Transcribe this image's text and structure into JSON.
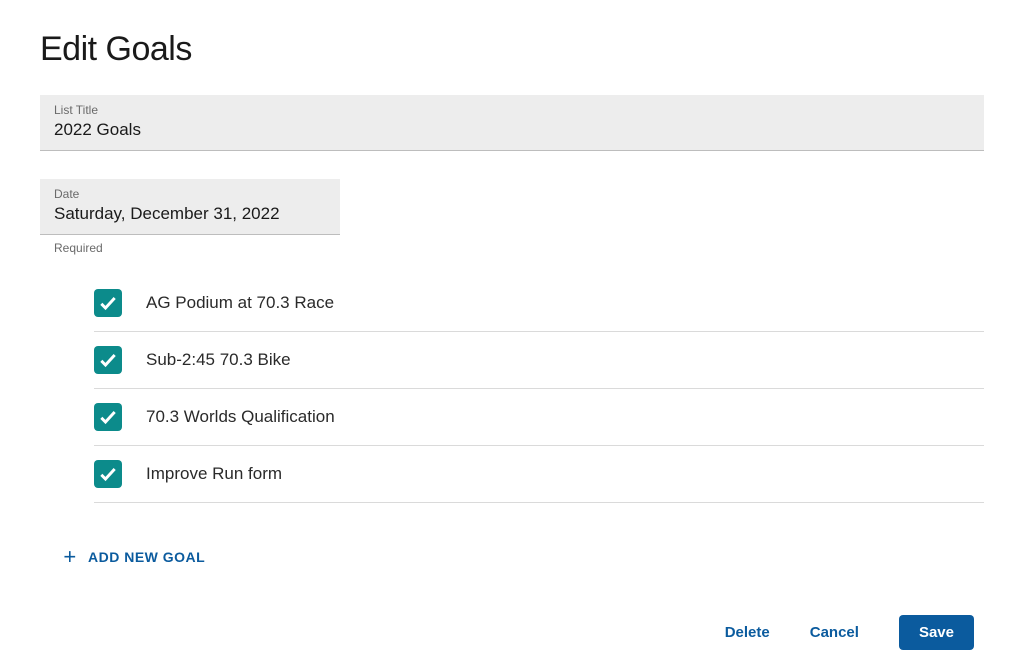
{
  "pageTitle": "Edit Goals",
  "listTitleField": {
    "label": "List Title",
    "value": "2022 Goals"
  },
  "dateField": {
    "label": "Date",
    "value": "Saturday, December 31, 2022",
    "helper": "Required"
  },
  "goals": [
    {
      "text": "AG Podium at 70.3 Race",
      "checked": true
    },
    {
      "text": "Sub-2:45 70.3 Bike",
      "checked": true
    },
    {
      "text": "70.3 Worlds Qualification",
      "checked": true
    },
    {
      "text": "Improve Run form",
      "checked": true
    }
  ],
  "addGoalLabel": "ADD NEW GOAL",
  "actions": {
    "delete": "Delete",
    "cancel": "Cancel",
    "save": "Save"
  }
}
